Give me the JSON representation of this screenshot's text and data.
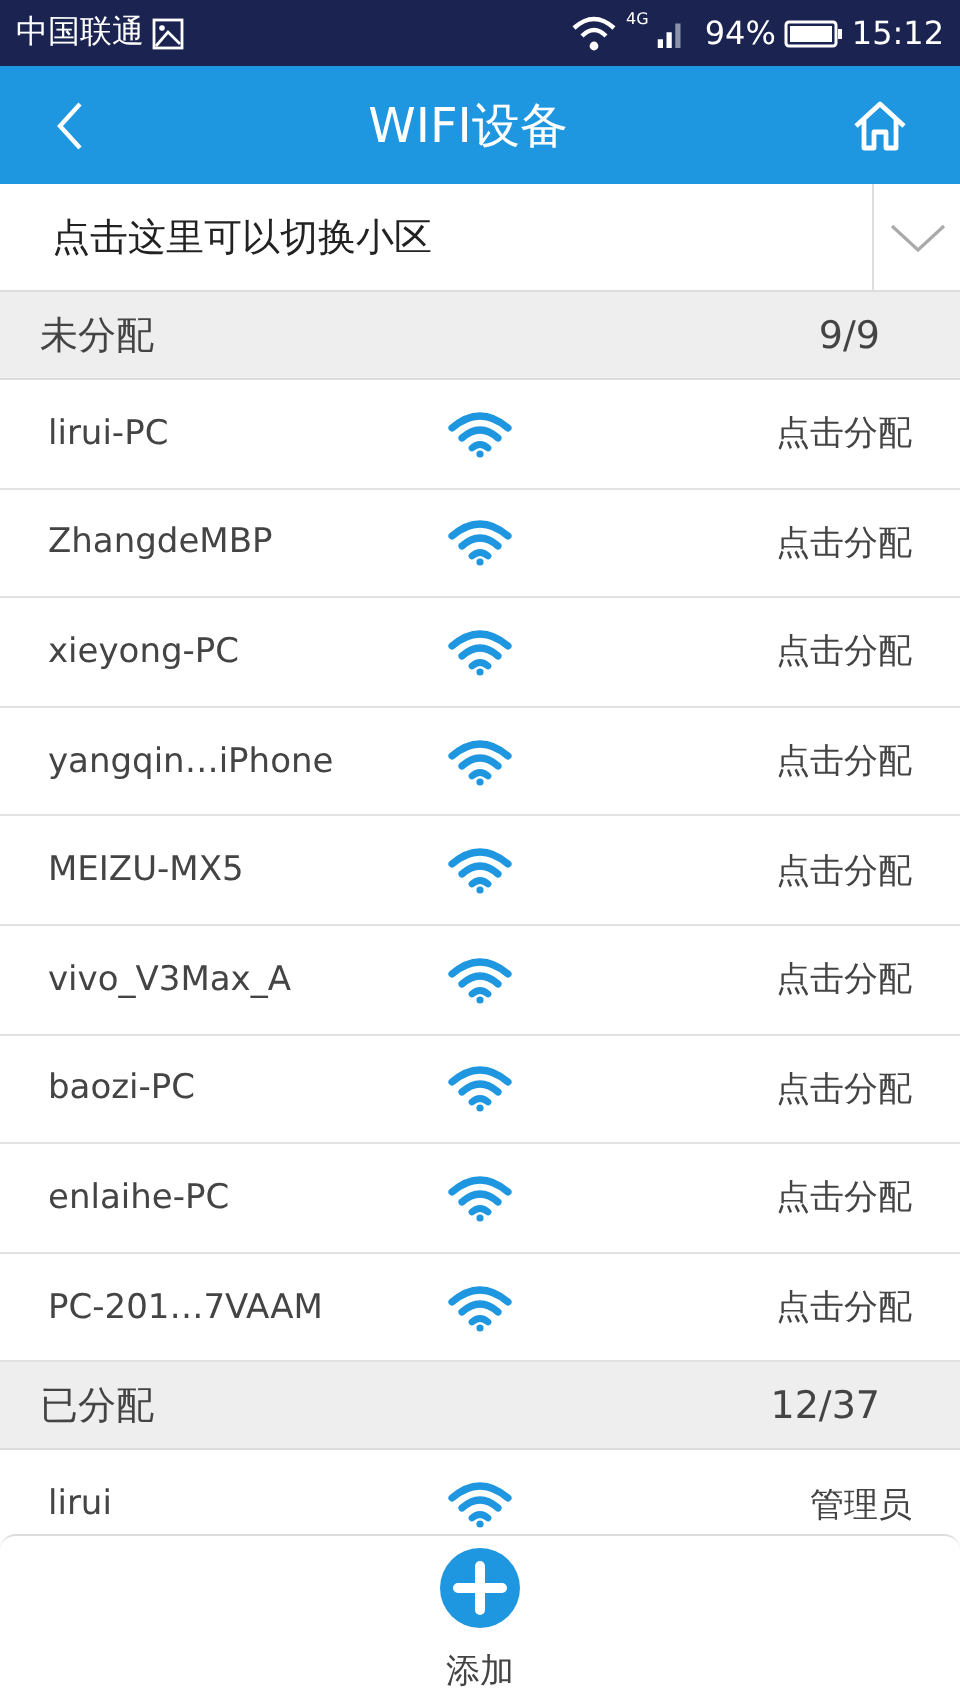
{
  "status_bar": {
    "carrier": "中国联通",
    "network": "4G",
    "battery": "94%",
    "time": "15:12"
  },
  "header": {
    "title": "WIFI设备"
  },
  "selector": {
    "placeholder": "点击这里可以切换小区"
  },
  "sections": [
    {
      "title": "未分配",
      "count": "9/9",
      "rows": [
        {
          "name": "lirui-PC",
          "action": "点击分配"
        },
        {
          "name": "ZhangdeMBP",
          "action": "点击分配"
        },
        {
          "name": "xieyong-PC",
          "action": "点击分配"
        },
        {
          "name": "yangqin…iPhone",
          "action": "点击分配"
        },
        {
          "name": "MEIZU-MX5",
          "action": "点击分配"
        },
        {
          "name": "vivo_V3Max_A",
          "action": "点击分配"
        },
        {
          "name": "baozi-PC",
          "action": "点击分配"
        },
        {
          "name": "enlaihe-PC",
          "action": "点击分配"
        },
        {
          "name": "PC-201…7VAAM",
          "action": "点击分配"
        }
      ]
    },
    {
      "title": "已分配",
      "count": "12/37",
      "rows": [
        {
          "name": "lirui",
          "action": "管理员"
        }
      ]
    }
  ],
  "bottom_bar": {
    "add_label": "添加"
  }
}
